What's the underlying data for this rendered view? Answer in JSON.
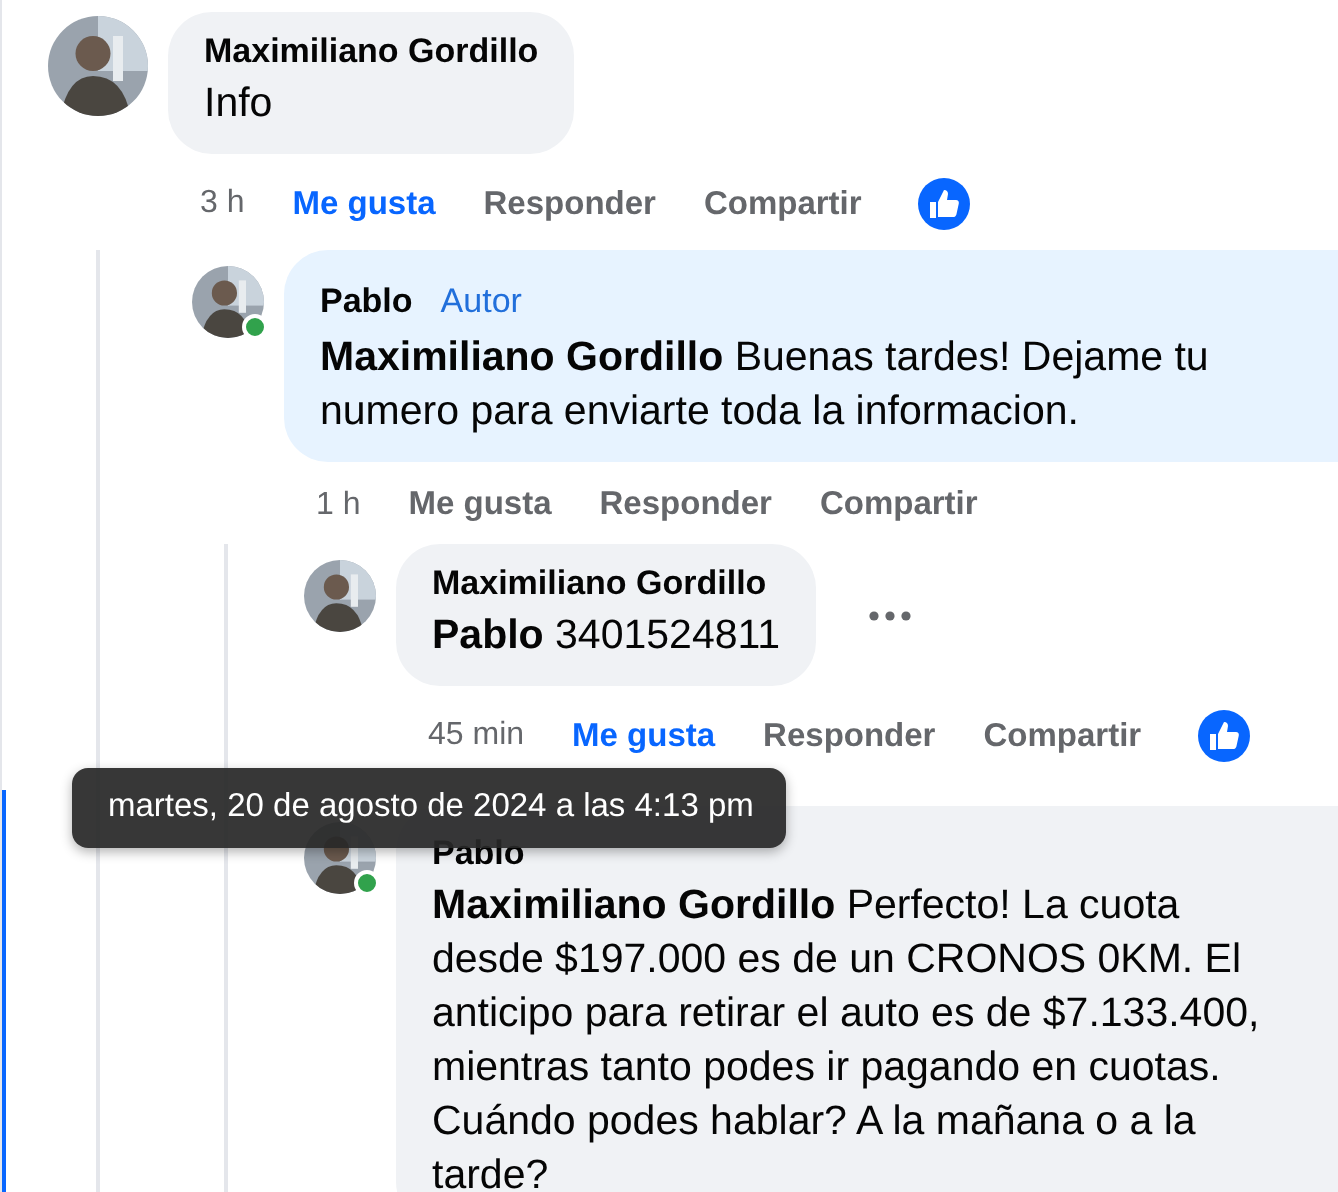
{
  "comments": [
    {
      "author": "Maximiliano Gordillo",
      "text": "Info",
      "online": false,
      "time": "3 h",
      "liked": true,
      "reacted": true,
      "actions": [
        "Me gusta",
        "Responder",
        "Compartir"
      ],
      "children": [
        {
          "author": "Pablo",
          "badge": "Autor",
          "mention": "Maximiliano Gordillo",
          "text": "Buenas tardes! Dejame tu numero para enviarte toda la informacion.",
          "online": true,
          "time": "1 h",
          "liked": false,
          "reacted": false,
          "actions": [
            "Me gusta",
            "Responder",
            "Compartir"
          ],
          "children": [
            {
              "author": "Maximiliano Gordillo",
              "mention": "Pablo",
              "text": "3401524811",
              "online": false,
              "time": "45 min",
              "liked": true,
              "reacted": true,
              "more": true,
              "actions": [
                "Me gusta",
                "Responder",
                "Compartir"
              ]
            },
            {
              "author": "Pablo",
              "mention": "Maximiliano Gordillo",
              "text": "Perfecto! La cuota desde $197.000 es de un CRONOS 0KM. El anticipo para retirar el auto es de $7.133.400, mientras tanto podes ir pagando en cuotas. Cuándo podes hablar? A la mañana o a la tarde?",
              "online": true,
              "highlighted": true,
              "tooltip": "martes, 20 de agosto de 2024 a las 4:13 pm"
            }
          ]
        }
      ]
    }
  ]
}
